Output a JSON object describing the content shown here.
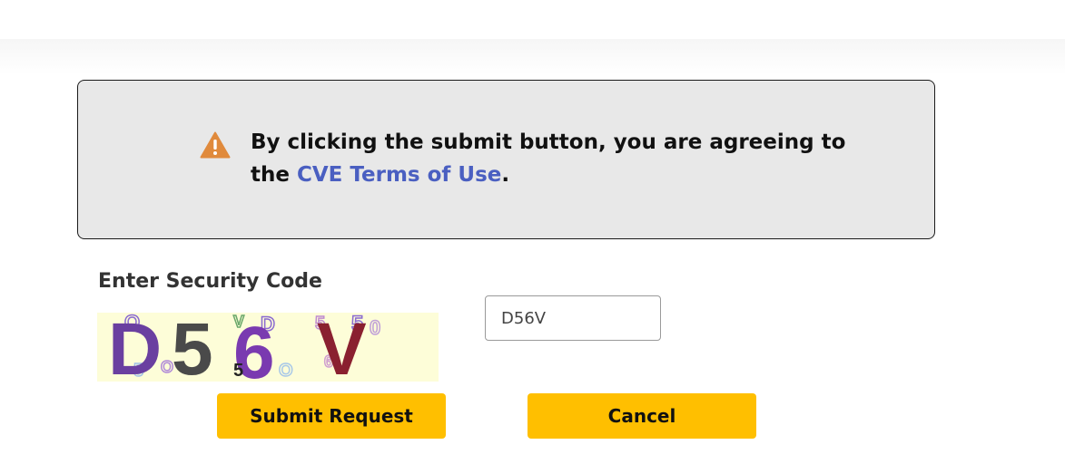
{
  "notice": {
    "text_before": "By clicking the submit button, you are agreeing to the ",
    "link_text": "CVE Terms of Use",
    "text_after": ".",
    "icon": "warning-triangle-icon",
    "icon_color": "#e08a3c",
    "link_color": "#4a5fc1"
  },
  "security": {
    "label": "Enter Security Code",
    "captcha_text": "D56V",
    "input_value": "D56V"
  },
  "buttons": {
    "submit_label": "Submit Request",
    "cancel_label": "Cancel",
    "color": "#ffbf00"
  }
}
